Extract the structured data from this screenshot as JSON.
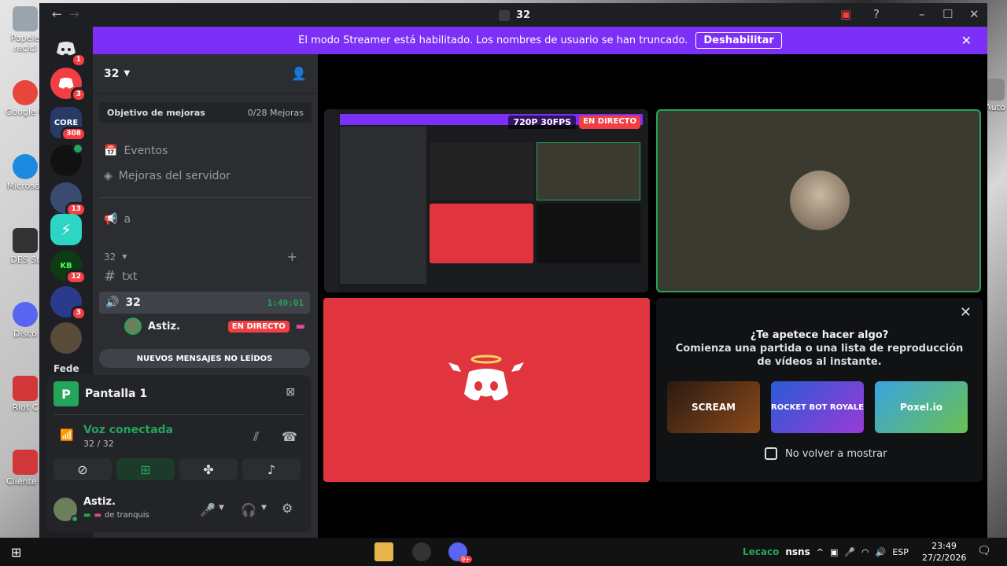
{
  "desktop": {
    "icons": [
      {
        "label": "Papele recicl"
      },
      {
        "label": "Google C"
      },
      {
        "label": "Microsot"
      },
      {
        "label": "DES St"
      },
      {
        "label": "Disco"
      },
      {
        "label": "Riot C"
      },
      {
        "label": "Cliente c"
      }
    ],
    "right_icon_label": "Auto"
  },
  "titlebar": {
    "title": "32"
  },
  "banner": {
    "text": "El modo Streamer está habilitado. Los nombres de usuario se han truncado.",
    "button": "Deshabilitar"
  },
  "servers": [
    {
      "badge": "1",
      "color": "#5865f2"
    },
    {
      "badge": "3",
      "color": "#f23f43"
    },
    {
      "badge": "308",
      "color": "#2a3a66",
      "text": "CORE"
    },
    {
      "badge": "",
      "color": "#111111"
    },
    {
      "badge": "13",
      "color": "#3a4a70"
    },
    {
      "badge": "",
      "color": "#2cd5c4"
    },
    {
      "badge": "12",
      "color": "#0d3b14",
      "text": "KB"
    },
    {
      "badge": "3",
      "color": "#2b3a8a"
    },
    {
      "badge": "",
      "color": "#5a4a3a"
    }
  ],
  "server_partial_label": "Fede",
  "channels": {
    "server_name": "32",
    "boost_label": "Objetivo de mejoras",
    "boost_value": "0/28 Mejoras",
    "events": "Eventos",
    "server_boosts": "Mejoras del servidor",
    "stage_a": "a",
    "category": "32",
    "text_channel": "txt",
    "voice_channel": "32",
    "voice_timer": "1:49:01",
    "member": "Astiz.",
    "member_live": "EN DIRECTO",
    "unread": "NUEVOS MENSAJES NO LEÍDOS"
  },
  "panel": {
    "stream_title": "Pantalla 1",
    "voice_status": "Voz conectada",
    "voice_sub": "32 / 32",
    "username": "Astiz.",
    "user_status": "de tranquis"
  },
  "stream": {
    "quality": "720P 30FPS",
    "live": "EN DIRECTO"
  },
  "activity": {
    "question": "¿Te apetece hacer algo?",
    "desc": "Comienza una partida o una lista de reproducción de vídeos al instante.",
    "games": [
      "SCREAM",
      "ROCKET BOT ROYALE",
      "Poxel.io"
    ],
    "checkbox_label": "No volver a mostrar"
  },
  "taskbar": {
    "user": "Lecaco",
    "text": "nsns",
    "lang": "ESP",
    "time": "23:49",
    "date": "27/2/2026",
    "app_badge": "9+"
  },
  "colors": {
    "discord_red": "#e0353f",
    "blurple": "#5865f2",
    "streamer_purple": "#7b2ff7",
    "green": "#23a55a"
  }
}
